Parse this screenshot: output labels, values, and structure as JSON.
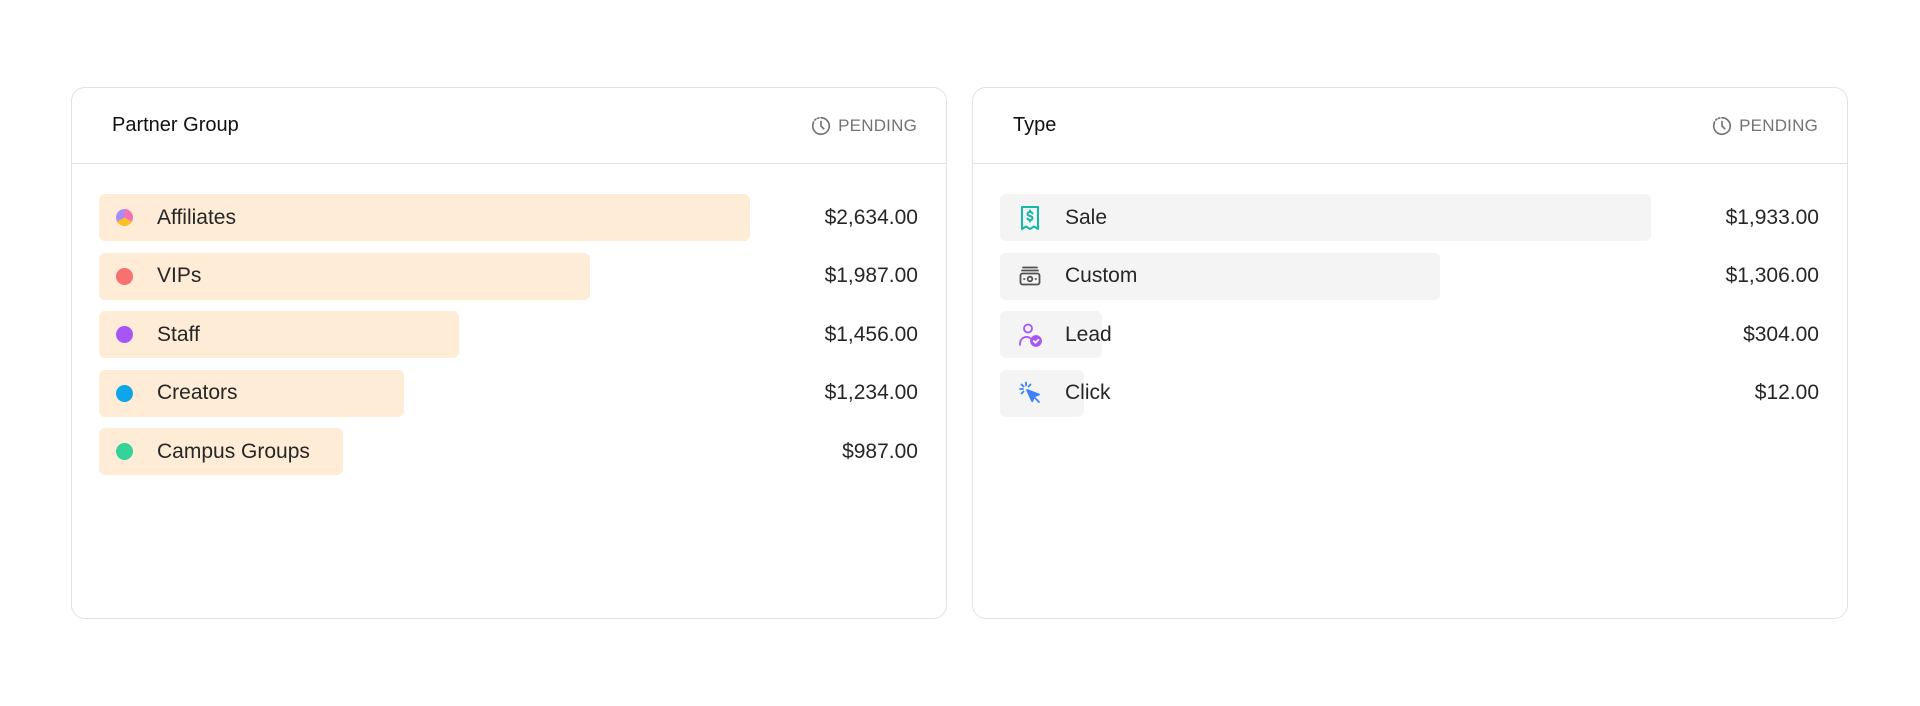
{
  "partner_group": {
    "title": "Partner Group",
    "status": "PENDING",
    "max_amount": 2634,
    "rows": [
      {
        "label": "Affiliates",
        "value": "$2,634.00",
        "amount": 2634,
        "dot": "gradient",
        "colors": [
          "#f472b6",
          "#fbbf24",
          "#a78bfa"
        ]
      },
      {
        "label": "VIPs",
        "value": "$1,987.00",
        "amount": 1987,
        "dot": "solid",
        "color": "#f87171"
      },
      {
        "label": "Staff",
        "value": "$1,456.00",
        "amount": 1456,
        "dot": "solid",
        "color": "#a855f7"
      },
      {
        "label": "Creators",
        "value": "$1,234.00",
        "amount": 1234,
        "dot": "solid",
        "color": "#0ea5e9"
      },
      {
        "label": "Campus Groups",
        "value": "$987.00",
        "amount": 987,
        "dot": "solid",
        "color": "#34d399"
      }
    ]
  },
  "type": {
    "title": "Type",
    "status": "PENDING",
    "max_amount": 1933,
    "rows": [
      {
        "label": "Sale",
        "value": "$1,933.00",
        "amount": 1933,
        "icon": "receipt-dollar-icon",
        "color": "#14b8a6"
      },
      {
        "label": "Custom",
        "value": "$1,306.00",
        "amount": 1306,
        "icon": "money-bill-icon",
        "color": "#525252"
      },
      {
        "label": "Lead",
        "value": "$304.00",
        "amount": 304,
        "icon": "user-check-icon",
        "color": "#a855f7"
      },
      {
        "label": "Click",
        "value": "$12.00",
        "amount": 12,
        "icon": "cursor-click-icon",
        "color": "#3b82f6"
      }
    ]
  }
}
